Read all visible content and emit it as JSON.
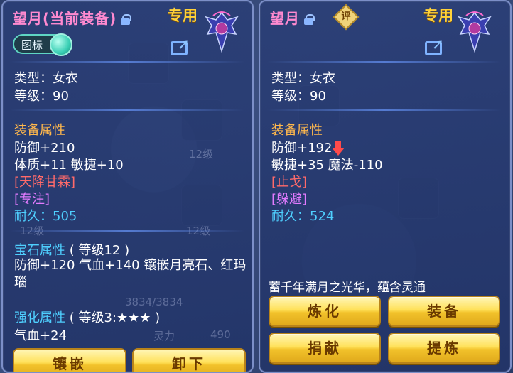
{
  "left_panel": {
    "item_name": "望月",
    "equipped_label": "(当前装备)",
    "exclusive": "专用",
    "toggle_label": "图标",
    "type_line": "类型：女衣",
    "level_line": "等级：90",
    "attr_header": "装备属性",
    "attr_lines": [
      "防御+210",
      "体质+11 敏捷+10"
    ],
    "special_effect": "[天降甘霖]",
    "special_skill": "[专注]",
    "durability_label": "耐久：",
    "durability_value": "505",
    "gem_header": "宝石属性",
    "gem_level": "( 等级12 )",
    "gem_line": "防御+120 气血+140 镶嵌月亮石、红玛瑙",
    "enhance_header": "强化属性",
    "enhance_level": "( 等级3:★★★ )",
    "enhance_line": "气血+24",
    "buttons": {
      "inlay": "镶嵌",
      "unequip": "卸下"
    }
  },
  "right_panel": {
    "item_name": "望月",
    "rate_badge": "评",
    "exclusive": "专用",
    "type_line": "类型：女衣",
    "level_line": "等级：90",
    "attr_header": "装备属性",
    "attr_line1": "防御+192",
    "attr_line2": "敏捷+35 魔法-110",
    "special_effect": "[止戈]",
    "special_skill": "[躲避]",
    "durability_label": "耐久：",
    "durability_value": "524",
    "description": "蓄千年满月之光华，蕴含灵通",
    "buttons": {
      "refine": "炼化",
      "equip": "装备",
      "donate": "捐献",
      "extract": "提炼"
    }
  },
  "background": {
    "level_tags": [
      "12级",
      "12级",
      "12级",
      "12级"
    ],
    "stat_fragments": [
      "3834/3834",
      "灵力",
      "490"
    ]
  },
  "colors": {
    "title_pink": "#ff8ad0",
    "exclusive_gold": "#ffd23a",
    "header_gold": "#ffb84d",
    "effect_red": "#ff6a6a",
    "skill_purple": "#e27bff",
    "durability_cyan": "#4fd0ff",
    "button_gold": "#f2c22b"
  },
  "icons": [
    "lock-icon",
    "share-icon",
    "toggle-knob",
    "emblem-icon",
    "down-arrow-icon",
    "rate-badge-icon"
  ]
}
